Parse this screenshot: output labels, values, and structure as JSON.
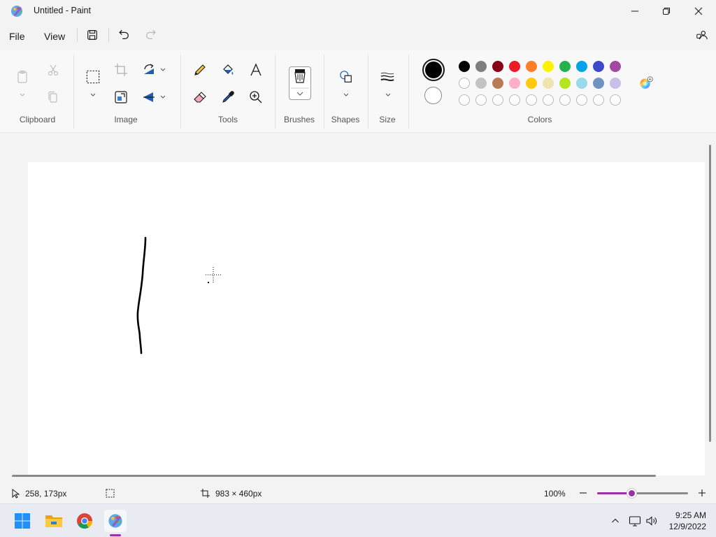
{
  "window": {
    "title": "Untitled - Paint"
  },
  "menu": {
    "file": "File",
    "view": "View"
  },
  "ribbon": {
    "groups": {
      "clipboard": "Clipboard",
      "image": "Image",
      "tools": "Tools",
      "brushes": "Brushes",
      "shapes": "Shapes",
      "size": "Size",
      "colors": "Colors"
    },
    "colors": {
      "primary": "#000000",
      "secondary": "#ffffff",
      "palette_row1": [
        "#000000",
        "#7f7f7f",
        "#880015",
        "#ed1c24",
        "#ff7f27",
        "#fff200",
        "#22b14c",
        "#00a2e8",
        "#3f48cc",
        "#a349a4"
      ],
      "palette_row2": [
        "#ffffff",
        "#c3c3c3",
        "#b97a57",
        "#ffaec9",
        "#ffc90e",
        "#efe4b0",
        "#b5e61d",
        "#99d9ea",
        "#7092be",
        "#c8bfe7"
      ]
    }
  },
  "status": {
    "cursor_position": "258, 173px",
    "canvas_size": "983 × 460px",
    "zoom": "100%",
    "zoom_fraction": 0.38
  },
  "taskbar": {
    "time": "9:25 AM",
    "date": "12/9/2022"
  }
}
